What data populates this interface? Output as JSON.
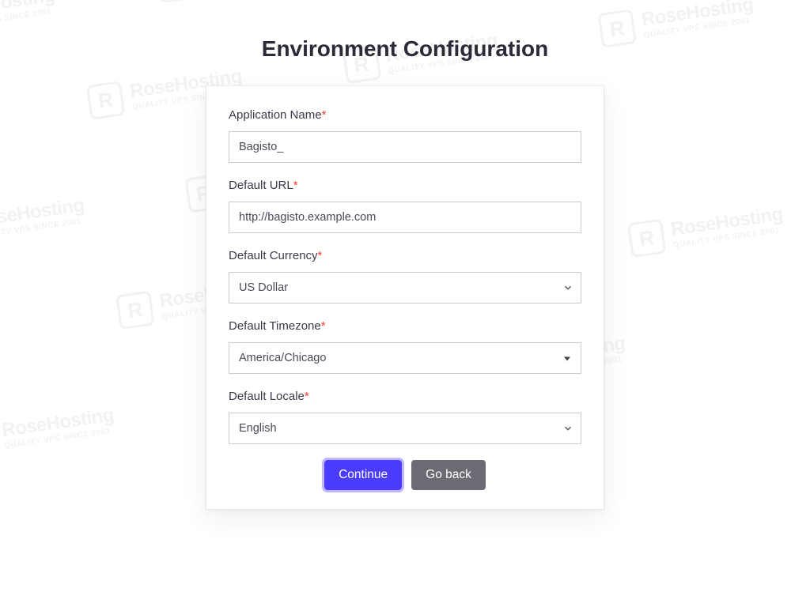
{
  "watermark": {
    "brand": "RoseHosting",
    "tagline": "QUALITY VPS SINCE 2001",
    "logo_letter": "R"
  },
  "title": "Environment Configuration",
  "form": {
    "app_name": {
      "label": "Application Name",
      "value": "Bagisto_"
    },
    "default_url": {
      "label": "Default URL",
      "value": "http://bagisto.example.com"
    },
    "default_currency": {
      "label": "Default Currency",
      "selected": "US Dollar"
    },
    "default_timezone": {
      "label": "Default Timezone",
      "selected": "America/Chicago"
    },
    "default_locale": {
      "label": "Default Locale",
      "selected": "English"
    }
  },
  "buttons": {
    "continue": "Continue",
    "back": "Go back"
  },
  "required_marker": "*"
}
